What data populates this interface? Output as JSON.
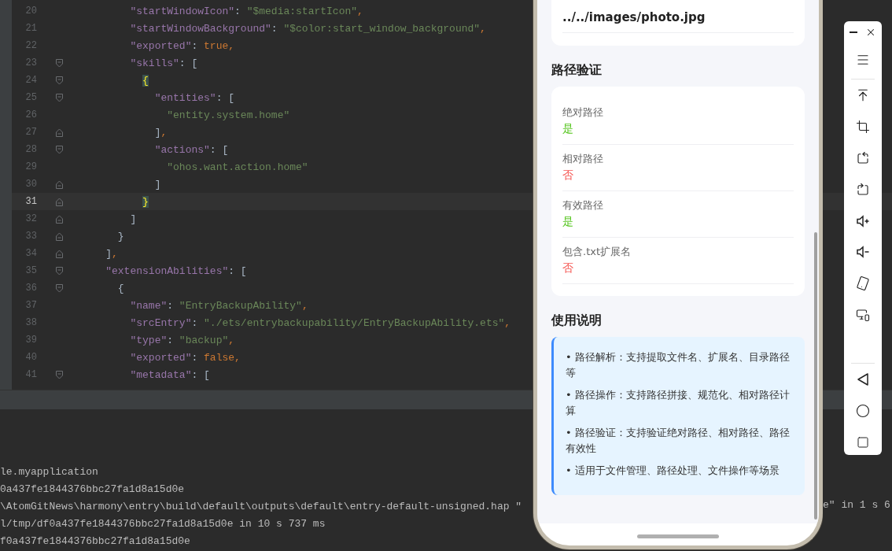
{
  "editor": {
    "lines": [
      {
        "number": "20",
        "current": false,
        "tokens": [
          {
            "kind": "key",
            "t": "        \"startWindowIcon\""
          },
          {
            "kind": "punct",
            "t": ": "
          },
          {
            "kind": "string",
            "t": "\"$media:startIcon\""
          },
          {
            "kind": "comma",
            "t": ","
          }
        ]
      },
      {
        "number": "21",
        "current": false,
        "tokens": [
          {
            "kind": "key",
            "t": "        \"startWindowBackground\""
          },
          {
            "kind": "punct",
            "t": ": "
          },
          {
            "kind": "string",
            "t": "\"$color:start_window_background\""
          },
          {
            "kind": "comma",
            "t": ","
          }
        ]
      },
      {
        "number": "22",
        "current": false,
        "tokens": [
          {
            "kind": "key",
            "t": "        \"exported\""
          },
          {
            "kind": "punct",
            "t": ": "
          },
          {
            "kind": "keyword",
            "t": "true"
          },
          {
            "kind": "comma",
            "t": ","
          }
        ]
      },
      {
        "number": "23",
        "current": false,
        "fold_marker": {
          "kind": "start"
        },
        "tokens": [
          {
            "kind": "key",
            "t": "        \"skills\""
          },
          {
            "kind": "punct",
            "t": ": ["
          }
        ]
      },
      {
        "number": "24",
        "current": false,
        "fold_marker": {
          "kind": "start"
        },
        "tokens": [
          {
            "kind": "brace",
            "t": "          {"
          }
        ]
      },
      {
        "number": "25",
        "current": false,
        "fold_marker": {
          "kind": "start"
        },
        "tokens": [
          {
            "kind": "key",
            "t": "            \"entities\""
          },
          {
            "kind": "punct",
            "t": ": ["
          }
        ]
      },
      {
        "number": "26",
        "current": false,
        "tokens": [
          {
            "kind": "string",
            "t": "              \"entity.system.home\""
          }
        ]
      },
      {
        "number": "27",
        "current": false,
        "fold_marker": {
          "kind": "end"
        },
        "tokens": [
          {
            "kind": "punct",
            "t": "            ]"
          },
          {
            "kind": "comma",
            "t": ","
          }
        ]
      },
      {
        "number": "28",
        "current": false,
        "fold_marker": {
          "kind": "start"
        },
        "tokens": [
          {
            "kind": "key",
            "t": "            \"actions\""
          },
          {
            "kind": "punct",
            "t": ": ["
          }
        ]
      },
      {
        "number": "29",
        "current": false,
        "tokens": [
          {
            "kind": "string",
            "t": "              \"ohos.want.action.home\""
          }
        ]
      },
      {
        "number": "30",
        "current": false,
        "fold_marker": {
          "kind": "end"
        },
        "tokens": [
          {
            "kind": "punct",
            "t": "            ]"
          }
        ]
      },
      {
        "number": "31",
        "current": true,
        "fold_marker": {
          "kind": "end"
        },
        "tokens": [
          {
            "kind": "brace",
            "t": "          }"
          }
        ]
      },
      {
        "number": "32",
        "current": false,
        "fold_marker": {
          "kind": "end"
        },
        "tokens": [
          {
            "kind": "punct",
            "t": "        ]"
          }
        ]
      },
      {
        "number": "33",
        "current": false,
        "fold_marker": {
          "kind": "end"
        },
        "tokens": [
          {
            "kind": "punct",
            "t": "      }"
          }
        ]
      },
      {
        "number": "34",
        "current": false,
        "fold_marker": {
          "kind": "end"
        },
        "tokens": [
          {
            "kind": "punct",
            "t": "    ]"
          },
          {
            "kind": "comma",
            "t": ","
          }
        ]
      },
      {
        "number": "35",
        "current": false,
        "fold_marker": {
          "kind": "start"
        },
        "tokens": [
          {
            "kind": "key",
            "t": "    \"extensionAbilities\""
          },
          {
            "kind": "punct",
            "t": ": ["
          }
        ]
      },
      {
        "number": "36",
        "current": false,
        "fold_marker": {
          "kind": "start"
        },
        "tokens": [
          {
            "kind": "punct",
            "t": "      {"
          }
        ]
      },
      {
        "number": "37",
        "current": false,
        "tokens": [
          {
            "kind": "key",
            "t": "        \"name\""
          },
          {
            "kind": "punct",
            "t": ": "
          },
          {
            "kind": "string",
            "t": "\"EntryBackupAbility\""
          },
          {
            "kind": "comma",
            "t": ","
          }
        ]
      },
      {
        "number": "38",
        "current": false,
        "tokens": [
          {
            "kind": "key",
            "t": "        \"srcEntry\""
          },
          {
            "kind": "punct",
            "t": ": "
          },
          {
            "kind": "string",
            "t": "\"./ets/entrybackupability/EntryBackupAbility.ets\""
          },
          {
            "kind": "comma",
            "t": ","
          }
        ]
      },
      {
        "number": "39",
        "current": false,
        "tokens": [
          {
            "kind": "key",
            "t": "        \"type\""
          },
          {
            "kind": "punct",
            "t": ": "
          },
          {
            "kind": "string",
            "t": "\"backup\""
          },
          {
            "kind": "comma",
            "t": ","
          }
        ]
      },
      {
        "number": "40",
        "current": false,
        "tokens": [
          {
            "kind": "key",
            "t": "        \"exported\""
          },
          {
            "kind": "punct",
            "t": ": "
          },
          {
            "kind": "keyword",
            "t": "false"
          },
          {
            "kind": "comma",
            "t": ","
          }
        ]
      },
      {
        "number": "41",
        "current": false,
        "fold_marker": {
          "kind": "start"
        },
        "tokens": [
          {
            "kind": "key",
            "t": "        \"metadata\""
          },
          {
            "kind": "punct",
            "t": ": ["
          }
        ]
      }
    ]
  },
  "console": {
    "lines": [
      "le.myapplication",
      "0a437fe1844376bbc27fa1d8a15d0e",
      "\\AtomGitNews\\harmony\\entry\\build\\default\\outputs\\default\\entry-default-unsigned.hap \"",
      "l/tmp/df0a437fe1844376bbc27fa1d8a15d0e in 10 s 737 ms",
      "f0a437fe1844376bbc27fa1d8a15d0e"
    ],
    "right_fragment": "e\" in 1 s 6"
  },
  "phone": {
    "path_card": {
      "value": "../../images/photo.jpg"
    },
    "validation": {
      "title": "路径验证",
      "rows": [
        {
          "label": "绝对路径",
          "value": "是",
          "ok": true
        },
        {
          "label": "相对路径",
          "value": "否",
          "ok": false
        },
        {
          "label": "有效路径",
          "value": "是",
          "ok": true
        },
        {
          "label": "包含.txt扩展名",
          "value": "否",
          "ok": false
        }
      ]
    },
    "usage": {
      "title": "使用说明",
      "items": [
        "• 路径解析：支持提取文件名、扩展名、目录路径等",
        "• 路径操作：支持路径拼接、规范化、相对路径计算",
        "• 路径验证：支持验证绝对路径、相对路径、路径有效性",
        "• 适用于文件管理、路径处理、文件操作等场景"
      ]
    }
  }
}
